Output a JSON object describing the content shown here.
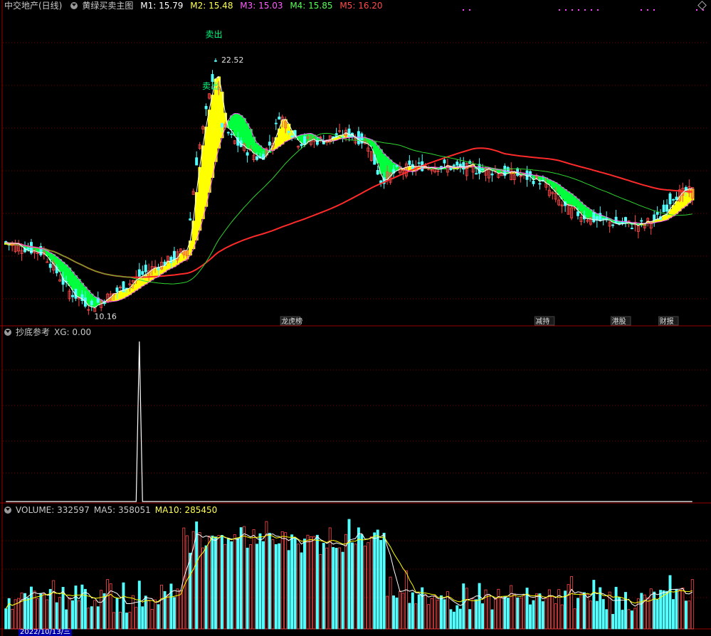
{
  "main_header": {
    "stock": "中交地产(日线)",
    "indicator": "黄绿买卖主图",
    "m1": "M1: 15.79",
    "m2": "M2: 15.48",
    "m3": "M3: 15.03",
    "m4": "M4: 15.85",
    "m5": "M5: 16.20"
  },
  "sub_header": {
    "name": "抄底参考",
    "xg": "XG: 0.00"
  },
  "vol_header": {
    "volume": "VOLUME: 332597",
    "ma5": "MA5: 358051",
    "ma10": "MA10: 285450"
  },
  "date_label": "2022/10/13/三",
  "colors": {
    "up": "#ff4a4a",
    "down": "#54ffff",
    "m1": "#ffffff",
    "m2": "#ff5cff",
    "m3": "#2fd52f",
    "m5": "#ff2a2a",
    "yellow": "#ffff00",
    "green": "#00ff3c",
    "ma5": "#ffffff",
    "ma10": "#ffff00",
    "grid": "#7a0000",
    "text": "#c8c8c8"
  },
  "chart_data": [
    {
      "type": "candlestick",
      "title": "黄绿买卖主图",
      "ylim": [
        9.6,
        24.2
      ],
      "high_label": "22.52",
      "low_label": "10.16",
      "signals": [
        {
          "label": "卖出",
          "idx": 64
        },
        {
          "label": "卖出",
          "idx": 65
        }
      ],
      "events": [
        {
          "label": "龙虎榜",
          "idx": 88
        },
        {
          "label": "减持",
          "idx": 168
        },
        {
          "label": "港股",
          "idx": 192
        },
        {
          "label": "财报",
          "idx": 207
        }
      ],
      "keypoints": [
        [
          0,
          13.4
        ],
        [
          12,
          12.9
        ],
        [
          20,
          11.1
        ],
        [
          27,
          10.4
        ],
        [
          36,
          11.2
        ],
        [
          46,
          12.2
        ],
        [
          52,
          12.6
        ],
        [
          57,
          13.1
        ],
        [
          60,
          17.2
        ],
        [
          64,
          20.2
        ],
        [
          66,
          22.0
        ],
        [
          68,
          18.9
        ],
        [
          72,
          18.1
        ],
        [
          80,
          17.3
        ],
        [
          84,
          18.2
        ],
        [
          86,
          19.4
        ],
        [
          88,
          19.0
        ],
        [
          92,
          18.1
        ],
        [
          100,
          18.2
        ],
        [
          108,
          18.5
        ],
        [
          114,
          18.0
        ],
        [
          118,
          16.3
        ],
        [
          124,
          16.8
        ],
        [
          132,
          17.0
        ],
        [
          142,
          16.9
        ],
        [
          150,
          16.8
        ],
        [
          160,
          16.6
        ],
        [
          168,
          16.3
        ],
        [
          176,
          15.0
        ],
        [
          184,
          14.5
        ],
        [
          192,
          14.3
        ],
        [
          200,
          14.2
        ],
        [
          206,
          14.6
        ],
        [
          210,
          15.6
        ],
        [
          216,
          15.8
        ]
      ]
    },
    {
      "type": "line",
      "title": "抄底参考",
      "series": [
        {
          "name": "XG",
          "spike_index": 42,
          "spike_value": 1,
          "last_value": 0
        }
      ]
    },
    {
      "type": "bar",
      "title": "VOLUME",
      "ma5_last": 358051,
      "ma10_last": 285450,
      "volume_last": 332597
    }
  ]
}
